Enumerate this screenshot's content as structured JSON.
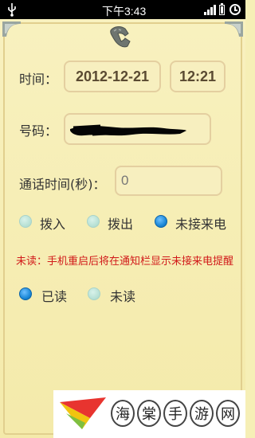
{
  "statusbar": {
    "time": "下午3:43",
    "icons": [
      "usb-icon",
      "signal-icon",
      "battery-icon",
      "alarm-clock-icon"
    ]
  },
  "form": {
    "time_label": "时间：",
    "date_value": "2012-12-21",
    "time_value": "12:21",
    "number_label": "号码：",
    "duration_label": "通话时间(秒)：",
    "duration_value": "0"
  },
  "call_type": {
    "options": [
      "拨入",
      "拨出",
      "未接来电"
    ],
    "selected": "未接来电"
  },
  "notice": "未读：手机重启后将在通知栏显示未接来电提醒",
  "read_status": {
    "options": [
      "已读",
      "未读"
    ],
    "selected": "已读"
  },
  "watermark": {
    "chars": [
      "海",
      "棠",
      "手",
      "游",
      "网"
    ]
  },
  "colors": {
    "background": "#f6efb6",
    "field_border": "#e4cfa0",
    "notice_red": "#d11a1a",
    "radio_selected": "#1c89d8"
  }
}
